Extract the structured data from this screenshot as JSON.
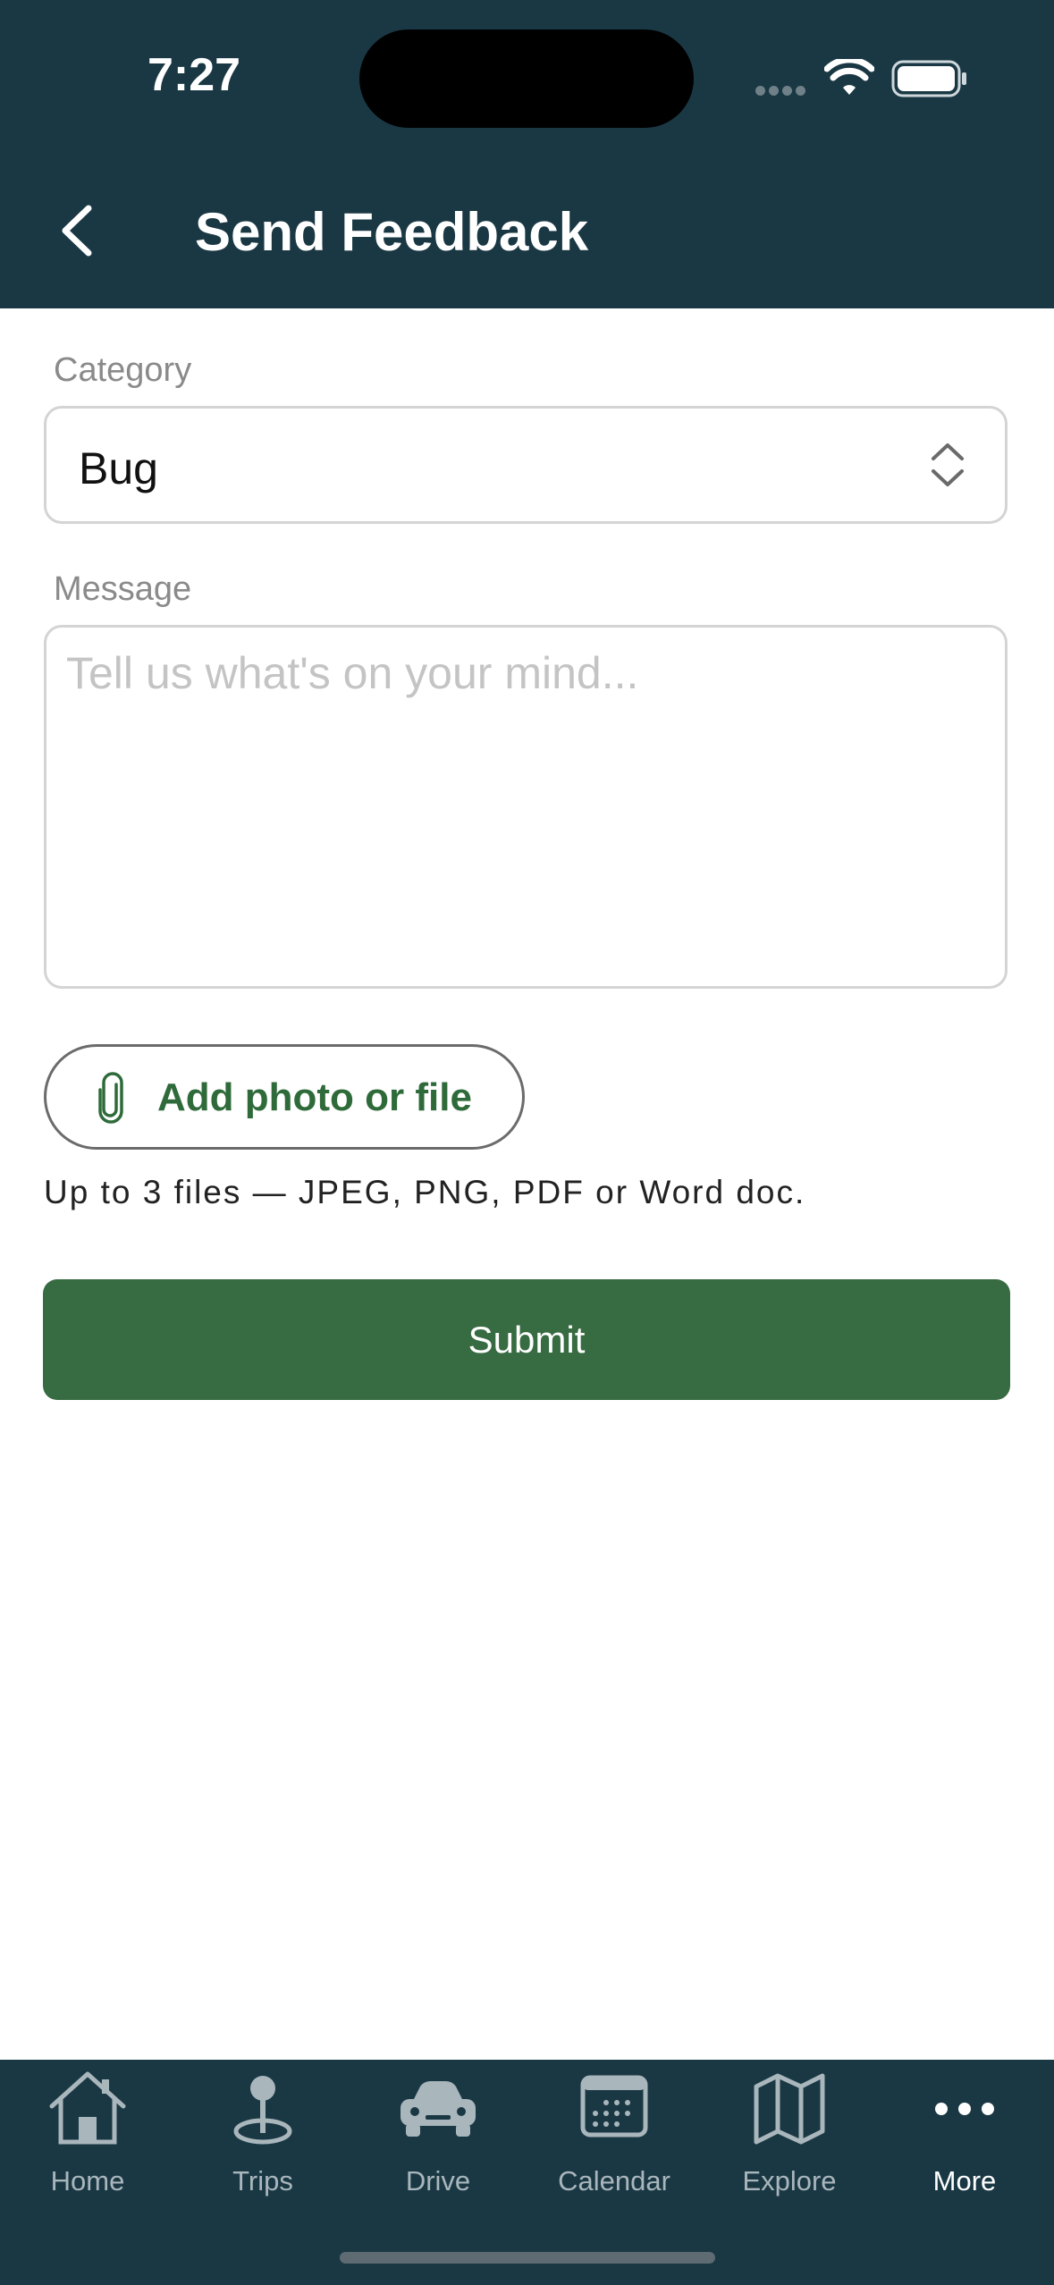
{
  "status_bar": {
    "time": "7:27"
  },
  "nav": {
    "title": "Send Feedback"
  },
  "form": {
    "category_label": "Category",
    "category_value": "Bug",
    "message_label": "Message",
    "message_placeholder": "Tell us what's on your mind...",
    "message_value": "",
    "attach_label": "Add photo or file",
    "attach_hint": "Up to 3 files — JPEG, PNG, PDF or Word doc.",
    "submit_label": "Submit"
  },
  "tabs": [
    {
      "label": "Home",
      "icon": "home-icon",
      "active": false
    },
    {
      "label": "Trips",
      "icon": "map-pin-icon",
      "active": false
    },
    {
      "label": "Drive",
      "icon": "car-icon",
      "active": false
    },
    {
      "label": "Calendar",
      "icon": "calendar-icon",
      "active": false
    },
    {
      "label": "Explore",
      "icon": "map-icon",
      "active": false
    },
    {
      "label": "More",
      "icon": "more-icon",
      "active": true
    }
  ],
  "colors": {
    "header_bg": "#1a3844",
    "accent_green": "#376b42",
    "attach_text": "#2f6b3a"
  }
}
